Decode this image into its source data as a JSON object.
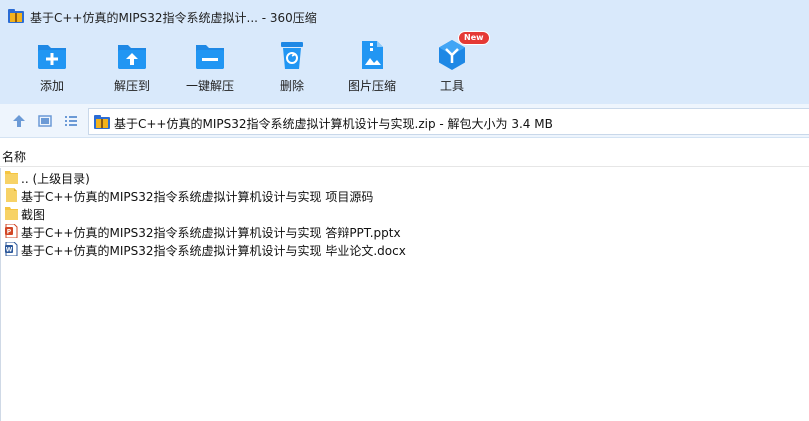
{
  "window": {
    "title": "基于C++仿真的MIPS32指令系统虚拟计... - 360压缩"
  },
  "toolbar": {
    "items": [
      {
        "label": "添加",
        "icon": "add-folder-icon"
      },
      {
        "label": "解压到",
        "icon": "extract-to-icon"
      },
      {
        "label": "一键解压",
        "icon": "one-click-extract-icon"
      },
      {
        "label": "删除",
        "icon": "delete-icon"
      },
      {
        "label": "图片压缩",
        "icon": "image-compress-icon"
      },
      {
        "label": "工具",
        "icon": "tools-icon",
        "badge": "New"
      }
    ]
  },
  "address": {
    "text": "基于C++仿真的MIPS32指令系统虚拟计算机设计与实现.zip - 解包大小为 3.4 MB"
  },
  "list": {
    "column_name": "名称",
    "items": [
      {
        "name": ".. (上级目录)",
        "type": "folder"
      },
      {
        "name": "基于C++仿真的MIPS32指令系统虚拟计算机设计与实现 项目源码",
        "type": "file"
      },
      {
        "name": "截图",
        "type": "folder"
      },
      {
        "name": "基于C++仿真的MIPS32指令系统虚拟计算机设计与实现  答辩PPT.pptx",
        "type": "pptx"
      },
      {
        "name": "基于C++仿真的MIPS32指令系统虚拟计算机设计与实现 毕业论文.docx",
        "type": "docx"
      }
    ]
  },
  "colors": {
    "toolbar_bg": "#d9e9fb",
    "icon_blue": "#1e88e5",
    "folder_yellow": "#f5c542",
    "badge_red": "#e53935"
  }
}
